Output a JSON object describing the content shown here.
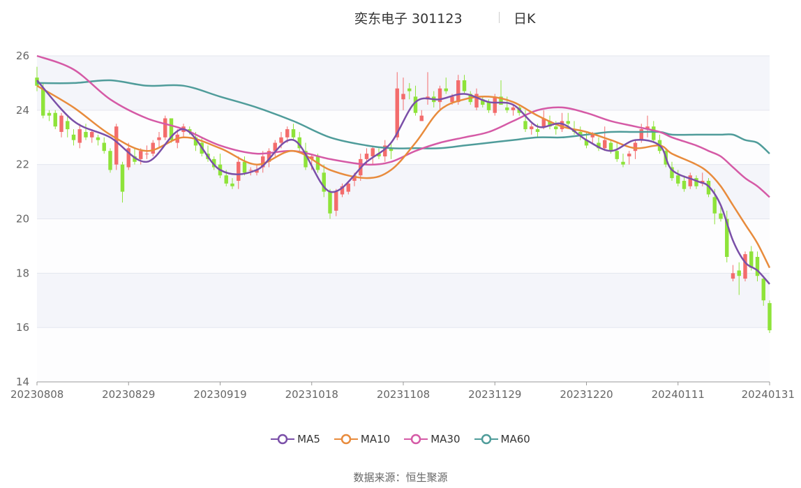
{
  "header": {
    "name_code": "奕东电子 301123",
    "period": "日K"
  },
  "source": {
    "label": "数据来源：",
    "value": "恒生聚源"
  },
  "colors": {
    "up": "#f36c6c",
    "down": "#8ee33a",
    "MA5": "#7a4fa8",
    "MA10": "#e88b3c",
    "MA30": "#d55aa6",
    "MA60": "#4f9c9a"
  },
  "chart_data": {
    "type": "candlestick",
    "title": "奕东电子 301123 日K",
    "ylim": [
      14,
      26
    ],
    "yticks": [
      14,
      16,
      18,
      20,
      22,
      24,
      26
    ],
    "xticks": [
      "20230808",
      "20230829",
      "20230919",
      "20231018",
      "20231108",
      "20231129",
      "20231220",
      "20240111",
      "20240131"
    ],
    "legend": [
      "MA5",
      "MA10",
      "MA30",
      "MA60"
    ],
    "legend_position": "bottom",
    "candles": [
      [
        25.2,
        25.6,
        24.7,
        24.9
      ],
      [
        24.8,
        25.0,
        23.7,
        23.8
      ],
      [
        23.9,
        24.0,
        23.6,
        23.8
      ],
      [
        23.9,
        24.0,
        23.3,
        23.4
      ],
      [
        23.2,
        23.9,
        23.0,
        23.8
      ],
      [
        23.6,
        23.8,
        23.0,
        23.3
      ],
      [
        23.1,
        23.3,
        22.7,
        22.9
      ],
      [
        22.8,
        23.5,
        22.6,
        23.3
      ],
      [
        23.2,
        23.5,
        22.9,
        23.0
      ],
      [
        23.0,
        23.3,
        22.8,
        23.2
      ],
      [
        23.0,
        23.1,
        22.7,
        22.9
      ],
      [
        22.8,
        23.0,
        22.4,
        22.5
      ],
      [
        22.5,
        22.6,
        21.7,
        21.8
      ],
      [
        22.0,
        23.5,
        21.8,
        23.4
      ],
      [
        22.0,
        22.1,
        20.6,
        21.0
      ],
      [
        21.9,
        22.8,
        21.8,
        22.6
      ],
      [
        22.3,
        22.6,
        22.0,
        22.1
      ],
      [
        22.2,
        22.6,
        22.0,
        22.5
      ],
      [
        22.4,
        22.7,
        22.2,
        22.4
      ],
      [
        22.4,
        22.9,
        22.3,
        22.8
      ],
      [
        22.9,
        23.2,
        22.6,
        23.0
      ],
      [
        23.0,
        23.8,
        22.9,
        23.7
      ],
      [
        23.7,
        23.7,
        22.8,
        22.9
      ],
      [
        22.8,
        23.3,
        22.6,
        23.1
      ],
      [
        23.2,
        23.5,
        23.0,
        23.4
      ],
      [
        23.3,
        23.4,
        23.1,
        23.2
      ],
      [
        23.0,
        23.2,
        22.5,
        22.7
      ],
      [
        22.8,
        23.0,
        22.3,
        22.4
      ],
      [
        22.4,
        22.7,
        22.1,
        22.2
      ],
      [
        22.2,
        22.3,
        21.8,
        21.9
      ],
      [
        22.0,
        22.4,
        21.5,
        21.6
      ],
      [
        21.6,
        21.8,
        21.2,
        21.3
      ],
      [
        21.3,
        21.5,
        21.1,
        21.2
      ],
      [
        21.4,
        22.3,
        21.1,
        22.1
      ],
      [
        22.1,
        22.3,
        21.6,
        21.7
      ],
      [
        21.8,
        21.9,
        21.6,
        21.8
      ],
      [
        21.7,
        22.0,
        21.6,
        21.8
      ],
      [
        21.9,
        22.5,
        21.7,
        22.3
      ],
      [
        22.1,
        22.6,
        21.9,
        22.5
      ],
      [
        22.5,
        22.9,
        22.3,
        22.8
      ],
      [
        22.8,
        23.2,
        22.6,
        23.0
      ],
      [
        23.0,
        23.4,
        22.8,
        23.3
      ],
      [
        23.3,
        23.5,
        22.9,
        23.0
      ],
      [
        23.0,
        23.2,
        22.5,
        22.6
      ],
      [
        22.5,
        22.8,
        21.8,
        21.9
      ],
      [
        22.2,
        22.4,
        21.8,
        22.3
      ],
      [
        22.3,
        22.4,
        21.7,
        21.8
      ],
      [
        21.7,
        22.0,
        20.8,
        21.0
      ],
      [
        21.0,
        21.1,
        20.0,
        20.2
      ],
      [
        20.3,
        21.1,
        20.1,
        21.0
      ],
      [
        20.9,
        21.3,
        20.8,
        21.2
      ],
      [
        21.0,
        21.4,
        20.9,
        21.3
      ],
      [
        21.4,
        21.7,
        21.2,
        21.6
      ],
      [
        21.6,
        22.4,
        21.4,
        22.2
      ],
      [
        22.2,
        22.6,
        22.0,
        22.4
      ],
      [
        22.3,
        22.7,
        22.0,
        22.6
      ],
      [
        22.4,
        22.6,
        22.2,
        22.3
      ],
      [
        22.3,
        22.9,
        22.1,
        22.7
      ],
      [
        22.6,
        22.8,
        22.2,
        22.5
      ],
      [
        23.0,
        25.4,
        22.9,
        24.8
      ],
      [
        24.4,
        25.2,
        24.0,
        24.6
      ],
      [
        24.8,
        25.0,
        24.4,
        24.7
      ],
      [
        24.5,
        24.9,
        23.8,
        23.9
      ],
      [
        23.6,
        24.0,
        23.6,
        23.8
      ],
      [
        24.4,
        25.4,
        24.2,
        24.5
      ],
      [
        24.5,
        24.7,
        24.1,
        24.3
      ],
      [
        24.3,
        24.9,
        24.0,
        24.8
      ],
      [
        24.8,
        25.2,
        24.6,
        24.7
      ],
      [
        24.3,
        24.6,
        24.2,
        24.5
      ],
      [
        24.3,
        25.3,
        24.2,
        25.1
      ],
      [
        25.1,
        25.3,
        24.6,
        24.7
      ],
      [
        24.6,
        24.7,
        24.2,
        24.3
      ],
      [
        24.1,
        24.8,
        24.0,
        24.6
      ],
      [
        24.4,
        24.5,
        24.1,
        24.2
      ],
      [
        24.3,
        24.4,
        23.9,
        24.0
      ],
      [
        23.9,
        24.6,
        23.8,
        24.5
      ],
      [
        24.5,
        25.1,
        24.2,
        24.2
      ],
      [
        24.1,
        24.5,
        23.9,
        24.0
      ],
      [
        24.0,
        24.2,
        23.8,
        24.1
      ],
      [
        24.1,
        24.2,
        23.8,
        23.9
      ],
      [
        23.6,
        24.0,
        23.2,
        23.3
      ],
      [
        23.3,
        23.5,
        23.1,
        23.4
      ],
      [
        23.3,
        23.5,
        23.0,
        23.2
      ],
      [
        23.4,
        24.0,
        23.3,
        23.7
      ],
      [
        23.6,
        23.8,
        23.3,
        23.4
      ],
      [
        23.4,
        23.6,
        23.1,
        23.3
      ],
      [
        23.3,
        23.9,
        23.2,
        23.6
      ],
      [
        23.6,
        23.9,
        23.4,
        23.5
      ],
      [
        23.3,
        23.6,
        23.1,
        23.2
      ],
      [
        23.2,
        23.4,
        22.9,
        23.1
      ],
      [
        22.9,
        23.2,
        22.6,
        22.7
      ],
      [
        23.0,
        23.2,
        22.8,
        23.1
      ],
      [
        22.8,
        23.0,
        22.5,
        22.6
      ],
      [
        22.6,
        23.4,
        22.5,
        22.9
      ],
      [
        22.8,
        22.9,
        22.4,
        22.5
      ],
      [
        22.5,
        22.8,
        22.1,
        22.2
      ],
      [
        22.1,
        22.4,
        21.9,
        22.0
      ],
      [
        22.3,
        22.5,
        22.0,
        22.4
      ],
      [
        22.5,
        22.9,
        22.2,
        22.8
      ],
      [
        22.9,
        23.5,
        22.8,
        23.3
      ],
      [
        23.3,
        23.8,
        23.0,
        23.4
      ],
      [
        23.4,
        23.6,
        22.8,
        22.9
      ],
      [
        22.9,
        23.1,
        22.4,
        22.5
      ],
      [
        22.5,
        22.6,
        21.9,
        22.0
      ],
      [
        21.9,
        22.1,
        21.4,
        21.5
      ],
      [
        21.6,
        21.8,
        21.2,
        21.3
      ],
      [
        21.4,
        21.6,
        21.0,
        21.1
      ],
      [
        21.2,
        21.7,
        21.1,
        21.6
      ],
      [
        21.5,
        21.6,
        21.1,
        21.2
      ],
      [
        21.3,
        21.7,
        21.2,
        21.4
      ],
      [
        21.4,
        21.5,
        20.8,
        20.9
      ],
      [
        20.8,
        21.1,
        19.8,
        20.2
      ],
      [
        20.2,
        20.5,
        19.9,
        20.0
      ],
      [
        20.0,
        20.3,
        18.4,
        18.6
      ],
      [
        17.8,
        18.3,
        17.7,
        18.0
      ],
      [
        18.1,
        18.4,
        17.2,
        17.9
      ],
      [
        17.8,
        18.8,
        17.7,
        18.7
      ],
      [
        18.8,
        19.0,
        18.1,
        18.2
      ],
      [
        18.6,
        18.8,
        17.7,
        17.9
      ],
      [
        17.8,
        17.9,
        16.8,
        17.0
      ],
      [
        16.9,
        17.0,
        15.8,
        15.9
      ]
    ],
    "series": [
      {
        "name": "MA5",
        "values": [
          [
            0,
            25.1
          ],
          [
            6,
            23.6
          ],
          [
            12,
            23.0
          ],
          [
            18,
            22.1
          ],
          [
            24,
            23.3
          ],
          [
            30,
            21.8
          ],
          [
            36,
            21.8
          ],
          [
            42,
            22.9
          ],
          [
            48,
            21.0
          ],
          [
            54,
            22.1
          ],
          [
            58,
            22.8
          ],
          [
            62,
            24.3
          ],
          [
            66,
            24.4
          ],
          [
            70,
            24.6
          ],
          [
            74,
            24.3
          ],
          [
            78,
            24.2
          ],
          [
            82,
            23.4
          ],
          [
            86,
            23.5
          ],
          [
            90,
            22.9
          ],
          [
            94,
            22.5
          ],
          [
            98,
            22.9
          ],
          [
            102,
            22.7
          ],
          [
            104,
            21.8
          ],
          [
            108,
            21.4
          ],
          [
            110,
            21.2
          ],
          [
            112,
            20.5
          ],
          [
            114,
            19.2
          ],
          [
            116,
            18.4
          ],
          [
            118,
            18.1
          ],
          [
            120,
            17.6
          ]
        ]
      },
      {
        "name": "MA10",
        "values": [
          [
            0,
            24.9
          ],
          [
            6,
            24.1
          ],
          [
            12,
            23.1
          ],
          [
            18,
            22.5
          ],
          [
            24,
            23.0
          ],
          [
            30,
            22.6
          ],
          [
            36,
            22.0
          ],
          [
            42,
            22.5
          ],
          [
            48,
            21.8
          ],
          [
            54,
            21.5
          ],
          [
            58,
            21.8
          ],
          [
            62,
            22.8
          ],
          [
            66,
            24.0
          ],
          [
            70,
            24.4
          ],
          [
            74,
            24.5
          ],
          [
            78,
            24.3
          ],
          [
            82,
            23.8
          ],
          [
            86,
            23.4
          ],
          [
            90,
            23.2
          ],
          [
            94,
            22.9
          ],
          [
            98,
            22.6
          ],
          [
            102,
            22.7
          ],
          [
            104,
            22.4
          ],
          [
            108,
            22.0
          ],
          [
            110,
            21.7
          ],
          [
            112,
            21.2
          ],
          [
            114,
            20.5
          ],
          [
            116,
            19.8
          ],
          [
            118,
            19.1
          ],
          [
            120,
            18.2
          ]
        ]
      },
      {
        "name": "MA30",
        "values": [
          [
            0,
            26.0
          ],
          [
            6,
            25.5
          ],
          [
            12,
            24.4
          ],
          [
            18,
            23.7
          ],
          [
            24,
            23.3
          ],
          [
            30,
            22.7
          ],
          [
            36,
            22.4
          ],
          [
            42,
            22.5
          ],
          [
            48,
            22.2
          ],
          [
            54,
            22.0
          ],
          [
            58,
            22.1
          ],
          [
            62,
            22.5
          ],
          [
            66,
            22.8
          ],
          [
            70,
            23.0
          ],
          [
            74,
            23.2
          ],
          [
            78,
            23.6
          ],
          [
            82,
            24.0
          ],
          [
            86,
            24.1
          ],
          [
            90,
            23.9
          ],
          [
            94,
            23.6
          ],
          [
            98,
            23.4
          ],
          [
            102,
            23.2
          ],
          [
            104,
            23.0
          ],
          [
            108,
            22.7
          ],
          [
            110,
            22.5
          ],
          [
            112,
            22.3
          ],
          [
            114,
            21.9
          ],
          [
            116,
            21.5
          ],
          [
            118,
            21.2
          ],
          [
            120,
            20.8
          ]
        ]
      },
      {
        "name": "MA60",
        "values": [
          [
            0,
            25.0
          ],
          [
            6,
            25.0
          ],
          [
            12,
            25.1
          ],
          [
            18,
            24.9
          ],
          [
            24,
            24.9
          ],
          [
            30,
            24.5
          ],
          [
            36,
            24.1
          ],
          [
            42,
            23.6
          ],
          [
            48,
            23.0
          ],
          [
            54,
            22.7
          ],
          [
            58,
            22.6
          ],
          [
            62,
            22.6
          ],
          [
            66,
            22.6
          ],
          [
            70,
            22.7
          ],
          [
            74,
            22.8
          ],
          [
            78,
            22.9
          ],
          [
            82,
            23.0
          ],
          [
            86,
            23.0
          ],
          [
            90,
            23.1
          ],
          [
            94,
            23.2
          ],
          [
            98,
            23.2
          ],
          [
            102,
            23.2
          ],
          [
            104,
            23.1
          ],
          [
            108,
            23.1
          ],
          [
            110,
            23.1
          ],
          [
            112,
            23.1
          ],
          [
            114,
            23.1
          ],
          [
            116,
            22.9
          ],
          [
            118,
            22.8
          ],
          [
            120,
            22.4
          ]
        ]
      }
    ]
  }
}
